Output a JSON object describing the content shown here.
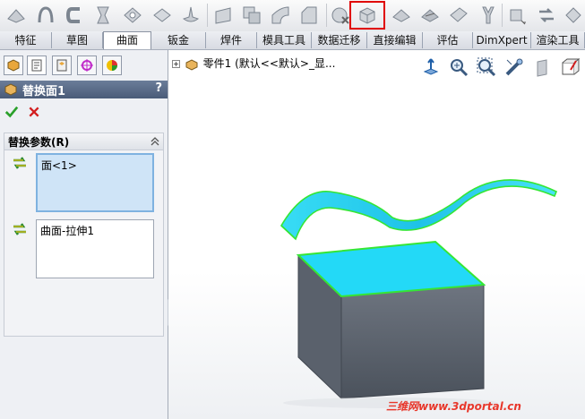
{
  "toolbar": {
    "icons": [
      "boundary-surface-icon",
      "loft-surface-icon",
      "ruled-surface-icon",
      "fill-surface-icon",
      "offset-surface-icon",
      "radiate-surface-icon",
      "knit-surface-icon",
      "planar-surface-icon",
      "extend-surface-icon",
      "trim-surface-icon",
      "untrim-surface-icon",
      "delete-face-icon",
      "replace-face-icon",
      "thicken-icon",
      "thicken-cut-icon",
      "cut-with-surface-icon",
      "mid-surface-icon",
      "move-face-icon",
      "delete-hole-icon",
      "more-icon"
    ],
    "highlighted": "replace-face-icon"
  },
  "tabs": [
    "特征",
    "草图",
    "曲面",
    "钣金",
    "焊件",
    "模具工具",
    "数据迁移",
    "直接编辑",
    "评估",
    "DimXpert",
    "渲染工具"
  ],
  "active_tab": "曲面",
  "panel_tabs": [
    "feature-manager-tab",
    "property-manager-tab",
    "configuration-manager-tab",
    "dimxpert-manager-tab",
    "display-manager-tab"
  ],
  "property_manager": {
    "title": "替换面1",
    "help": "?",
    "group_title": "替换参数(R)",
    "target_faces": "面<1>",
    "replacement_surface": "曲面-拉伸1"
  },
  "tree": {
    "expander": "+",
    "label": "零件1 (默认<<默认>_显..."
  },
  "heads_up_icons": [
    "view-orientation-icon",
    "zoom-to-fit-icon",
    "zoom-to-area-icon",
    "section-view-icon",
    "display-style-icon",
    "hide-show-icon"
  ],
  "watermark": "三维网www.3dportal.cn",
  "colors": {
    "highlight_face": "#22d7f5",
    "edge": "#35e635",
    "box_side": "#5e6670",
    "highlight_box": "#e00000"
  }
}
